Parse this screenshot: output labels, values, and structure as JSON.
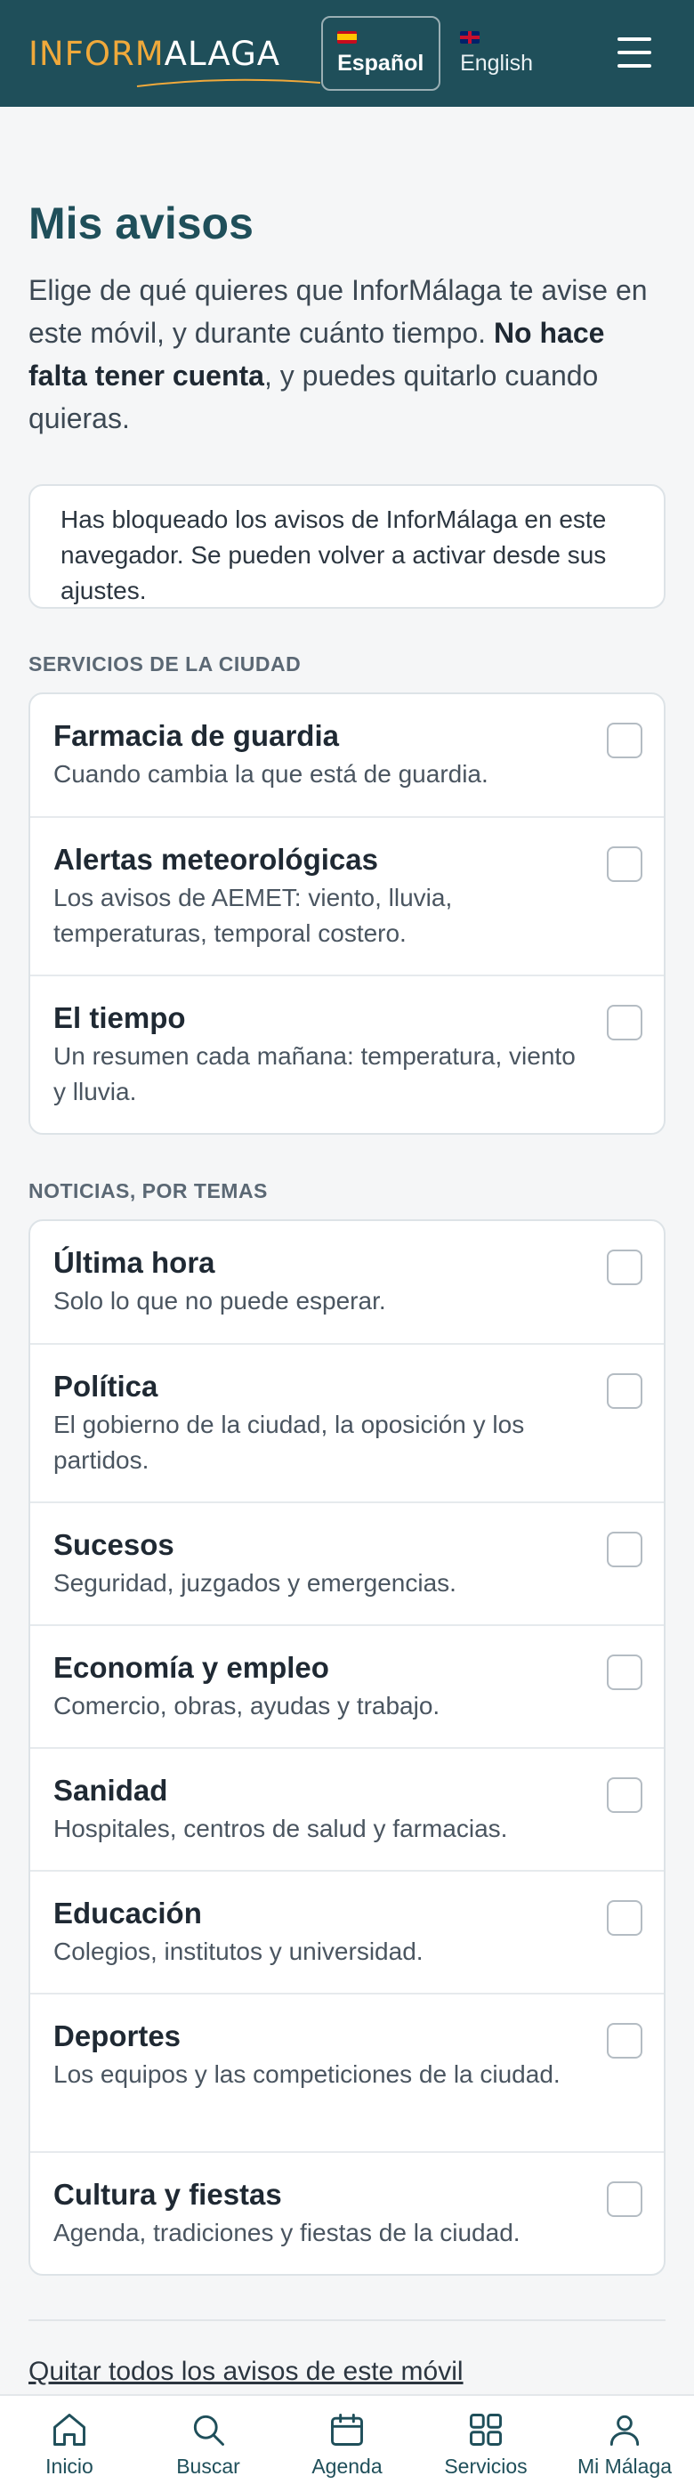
{
  "header": {
    "logo_part1": "INFORM",
    "logo_part2": "ALAGA",
    "languages": [
      {
        "label": "Español",
        "active": true
      },
      {
        "label": "English",
        "active": false
      }
    ]
  },
  "main": {
    "title": "Mis avisos",
    "intro_pre": "Elige de qué quieres que InforMálaga te avise en este móvil, y durante cuánto tiempo. ",
    "intro_bold": "No hace falta tener cuenta",
    "intro_post": ", y puedes quitarlo cuando quieras.",
    "notice": "Has bloqueado los avisos de InforMálaga en este navegador. Se pueden volver a activar desde sus ajustes."
  },
  "sections": [
    {
      "label": "SERVICIOS DE LA CIUDAD",
      "items": [
        {
          "title": "Farmacia de guardia",
          "desc": "Cuando cambia la que está de guardia.",
          "checked": false
        },
        {
          "title": "Alertas meteorológicas",
          "desc": "Los avisos de AEMET: viento, lluvia, temperaturas, temporal costero.",
          "checked": false
        },
        {
          "title": "El tiempo",
          "desc": "Un resumen cada mañana: temperatura, viento y lluvia.",
          "checked": false
        }
      ]
    },
    {
      "label": "NOTICIAS, POR TEMAS",
      "items": [
        {
          "title": "Última hora",
          "desc": "Solo lo que no puede esperar.",
          "checked": false
        },
        {
          "title": "Política",
          "desc": "El gobierno de la ciudad, la oposición y los partidos.",
          "checked": false
        },
        {
          "title": "Sucesos",
          "desc": "Seguridad, juzgados y emergencias.",
          "checked": false
        },
        {
          "title": "Economía y empleo",
          "desc": "Comercio, obras, ayudas y trabajo.",
          "checked": false
        },
        {
          "title": "Sanidad",
          "desc": "Hospitales, centros de salud y farmacias.",
          "checked": false
        },
        {
          "title": "Educación",
          "desc": "Colegios, institutos y universidad.",
          "checked": false
        },
        {
          "title": "Deportes",
          "desc": "Los equipos y las competiciones de la ciudad.",
          "checked": false
        },
        {
          "title": "Cultura y fiestas",
          "desc": "Agenda, tradiciones y fiestas de la ciudad.",
          "checked": false
        }
      ]
    }
  ],
  "footer_link": "Quitar todos los avisos de este móvil",
  "bottom_nav": [
    {
      "label": "Inicio",
      "icon": "home-icon"
    },
    {
      "label": "Buscar",
      "icon": "search-icon"
    },
    {
      "label": "Agenda",
      "icon": "calendar-icon"
    },
    {
      "label": "Servicios",
      "icon": "grid-icon"
    },
    {
      "label": "Mi Málaga",
      "icon": "user-icon"
    }
  ],
  "colors": {
    "header_bg": "#1f4f5a",
    "logo_accent": "#f0a93b",
    "title": "#1f4f5a"
  }
}
